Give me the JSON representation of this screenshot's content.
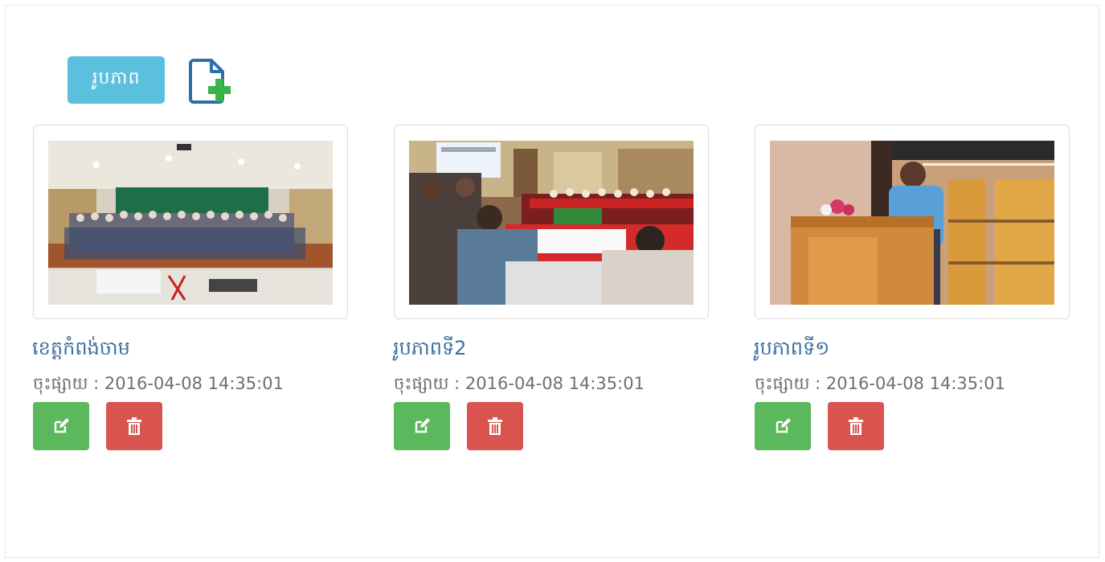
{
  "toolbar": {
    "tag_label": "រូបភាព",
    "add_icon": "add-file-icon"
  },
  "colors": {
    "tag_bg": "#5bc0de",
    "edit_bg": "#5cb85c",
    "delete_bg": "#d9534f",
    "title_text": "#3d6f9e",
    "meta_text": "#6f6f6f"
  },
  "cards": [
    {
      "title": "ខេត្តកំពង់ចាម",
      "published": "ចុះផ្សាយ : 2016-04-08 14:35:01",
      "image": "group-photo",
      "edit_icon": "edit-icon",
      "delete_icon": "trash-icon"
    },
    {
      "title": "រូបភាពទី2",
      "published": "ចុះផ្សាយ : 2016-04-08 14:35:01",
      "image": "meeting-photo",
      "edit_icon": "edit-icon",
      "delete_icon": "trash-icon"
    },
    {
      "title": "រូបភាពទី១",
      "published": "ចុះផ្សាយ : 2016-04-08 14:35:01",
      "image": "speaker-photo",
      "edit_icon": "edit-icon",
      "delete_icon": "trash-icon"
    }
  ]
}
